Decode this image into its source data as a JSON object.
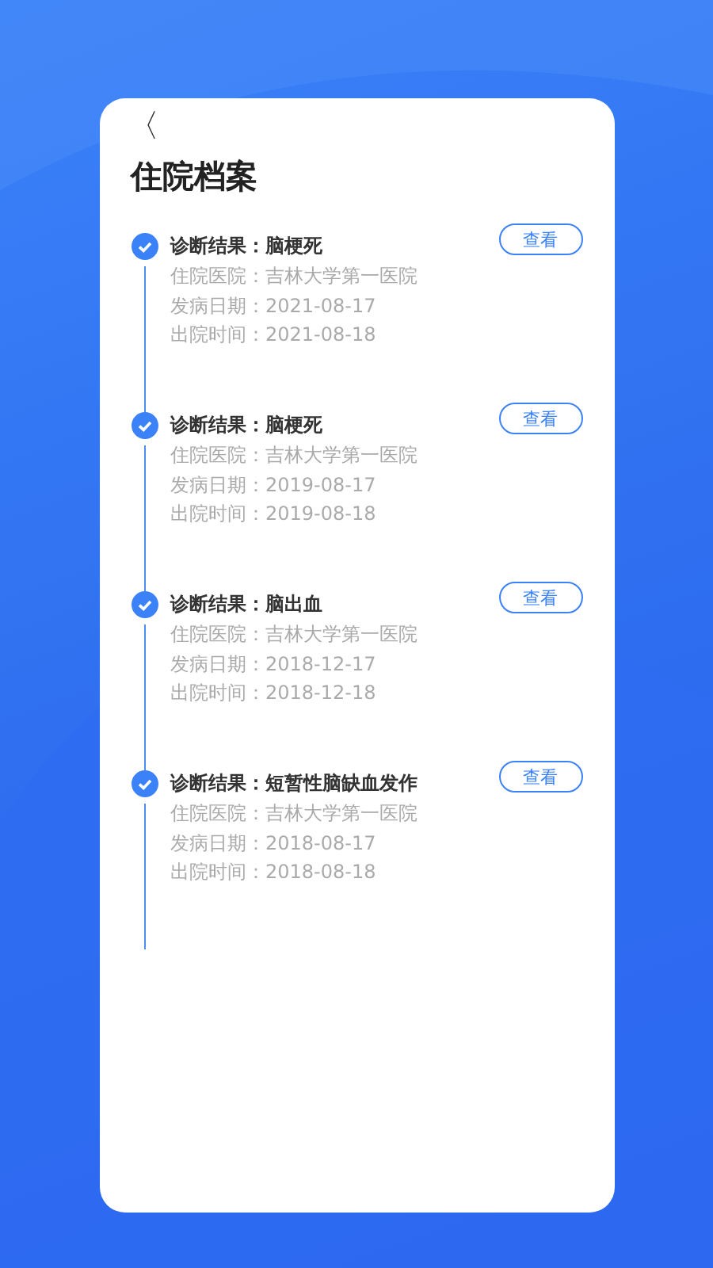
{
  "back": "〈",
  "title": "住院档案",
  "records": [
    {
      "checked": true,
      "diagnosis": "诊断结果：脑梗死",
      "hospital": "住院医院：吉林大学第一医院",
      "onset": "发病日期：2021-08-17",
      "discharge": "出院时间：2021-08-18",
      "button": "查看"
    },
    {
      "checked": true,
      "diagnosis": "诊断结果：脑梗死",
      "hospital": "住院医院：吉林大学第一医院",
      "onset": "发病日期：2019-08-17",
      "discharge": "出院时间：2019-08-18",
      "button": "查看"
    },
    {
      "checked": true,
      "diagnosis": "诊断结果：脑出血",
      "hospital": "住院医院：吉林大学第一医院",
      "onset": "发病日期：2018-12-17",
      "discharge": "出院时间：2018-12-18",
      "button": "查看"
    },
    {
      "checked": true,
      "diagnosis": "诊断结果：短暂性脑缺血发作",
      "hospital": "住院医院：吉林大学第一医院",
      "onset": "发病日期：2018-08-17",
      "discharge": "出院时间：2018-08-18",
      "button": "查看"
    }
  ]
}
